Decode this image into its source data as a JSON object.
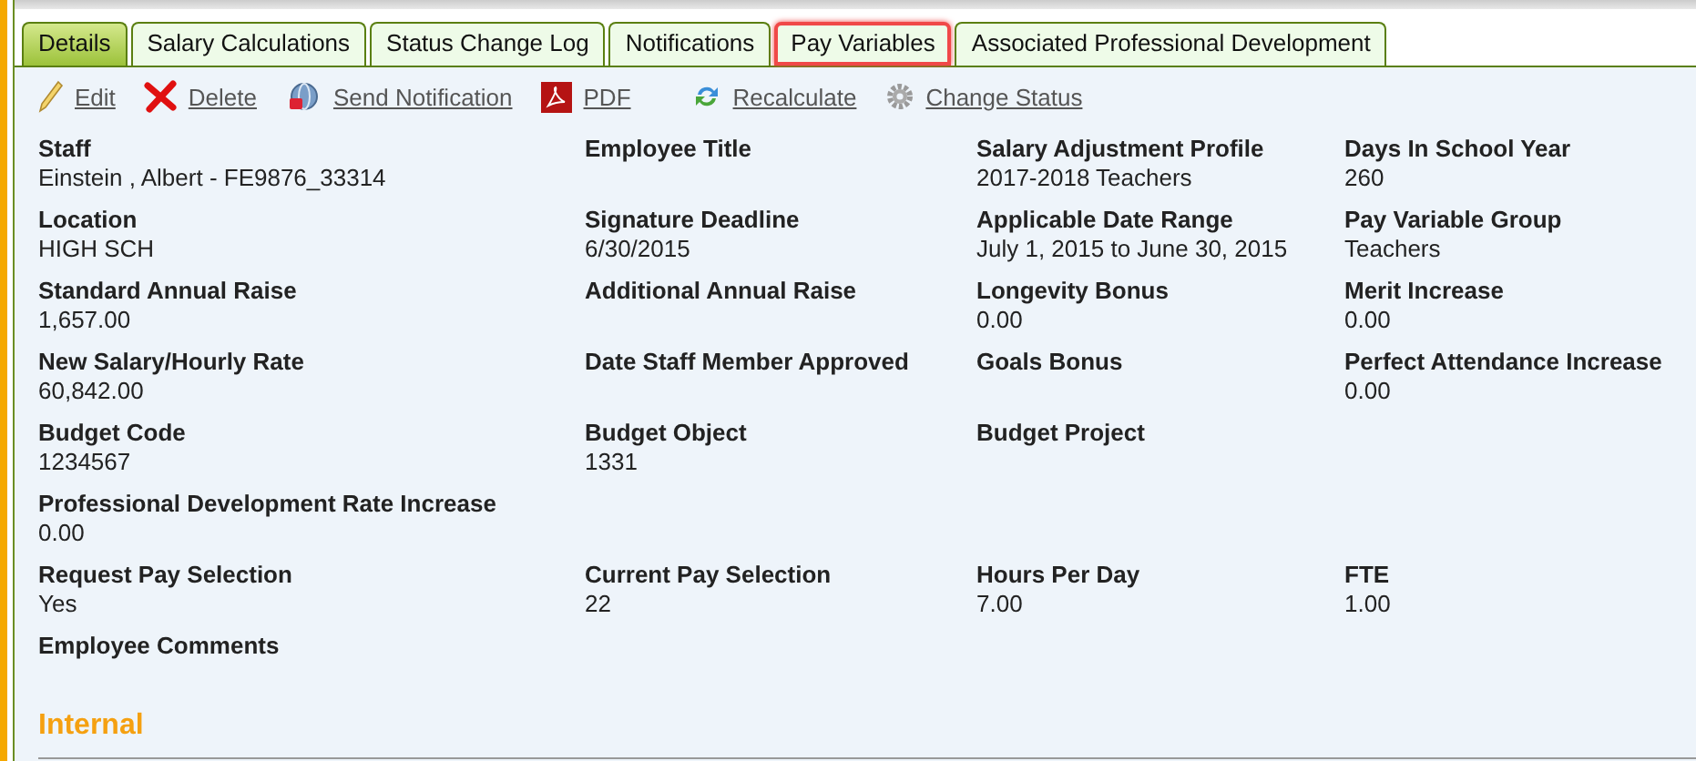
{
  "tabs": [
    {
      "label": "Details",
      "selected": true,
      "highlighted": false
    },
    {
      "label": "Salary Calculations",
      "selected": false,
      "highlighted": false
    },
    {
      "label": "Status Change Log",
      "selected": false,
      "highlighted": false
    },
    {
      "label": "Notifications",
      "selected": false,
      "highlighted": false
    },
    {
      "label": "Pay Variables",
      "selected": false,
      "highlighted": true
    },
    {
      "label": "Associated Professional Development",
      "selected": false,
      "highlighted": false
    }
  ],
  "toolbar": [
    {
      "kind": "edit",
      "label": "Edit"
    },
    {
      "kind": "delete",
      "label": "Delete"
    },
    {
      "kind": "notify",
      "label": "Send Notification"
    },
    {
      "kind": "pdf",
      "label": "PDF"
    },
    {
      "kind": "recalculate",
      "label": "Recalculate"
    },
    {
      "kind": "status",
      "label": "Change Status"
    }
  ],
  "rows": [
    [
      {
        "label": "Staff",
        "value": "Einstein , Albert - FE9876_33314"
      },
      {
        "label": "Employee Title"
      },
      {
        "label": "Salary Adjustment Profile",
        "value": "2017-2018 Teachers"
      },
      {
        "label": "Days In School Year",
        "value": "260"
      }
    ],
    [
      {
        "label": "Location",
        "value": "HIGH SCH"
      },
      {
        "label": "Signature Deadline",
        "value": "6/30/2015"
      },
      {
        "label": "Applicable Date Range",
        "value": "July 1, 2015 to June 30, 2015"
      },
      {
        "label": "Pay Variable Group",
        "value": "Teachers"
      }
    ],
    [
      {
        "label": "Standard Annual Raise",
        "value": "1,657.00"
      },
      {
        "label": "Additional Annual Raise"
      },
      {
        "label": "Longevity Bonus",
        "value": "0.00"
      },
      {
        "label": "Merit Increase",
        "value": "0.00"
      }
    ],
    [
      {
        "label": "New Salary/Hourly Rate",
        "value": "60,842.00"
      },
      {
        "label": "Date Staff Member Approved"
      },
      {
        "label": "Goals Bonus"
      },
      {
        "label": "Perfect Attendance Increase",
        "value": "0.00"
      }
    ],
    [
      {
        "label": "Budget Code",
        "value": "1234567"
      },
      {
        "label": "Budget Object",
        "value": "1331"
      },
      {
        "label": "Budget Project"
      }
    ],
    [
      {
        "label": "Professional Development Rate Increase",
        "value": "0.00"
      }
    ],
    [
      {
        "label": "Request Pay Selection",
        "value": "Yes"
      },
      {
        "label": "Current Pay Selection",
        "value": "22"
      },
      {
        "label": "Hours Per Day",
        "value": "7.00"
      },
      {
        "label": "FTE",
        "value": "1.00"
      }
    ],
    [
      {
        "label": "Employee Comments"
      }
    ]
  ],
  "section": {
    "title": "Internal"
  }
}
